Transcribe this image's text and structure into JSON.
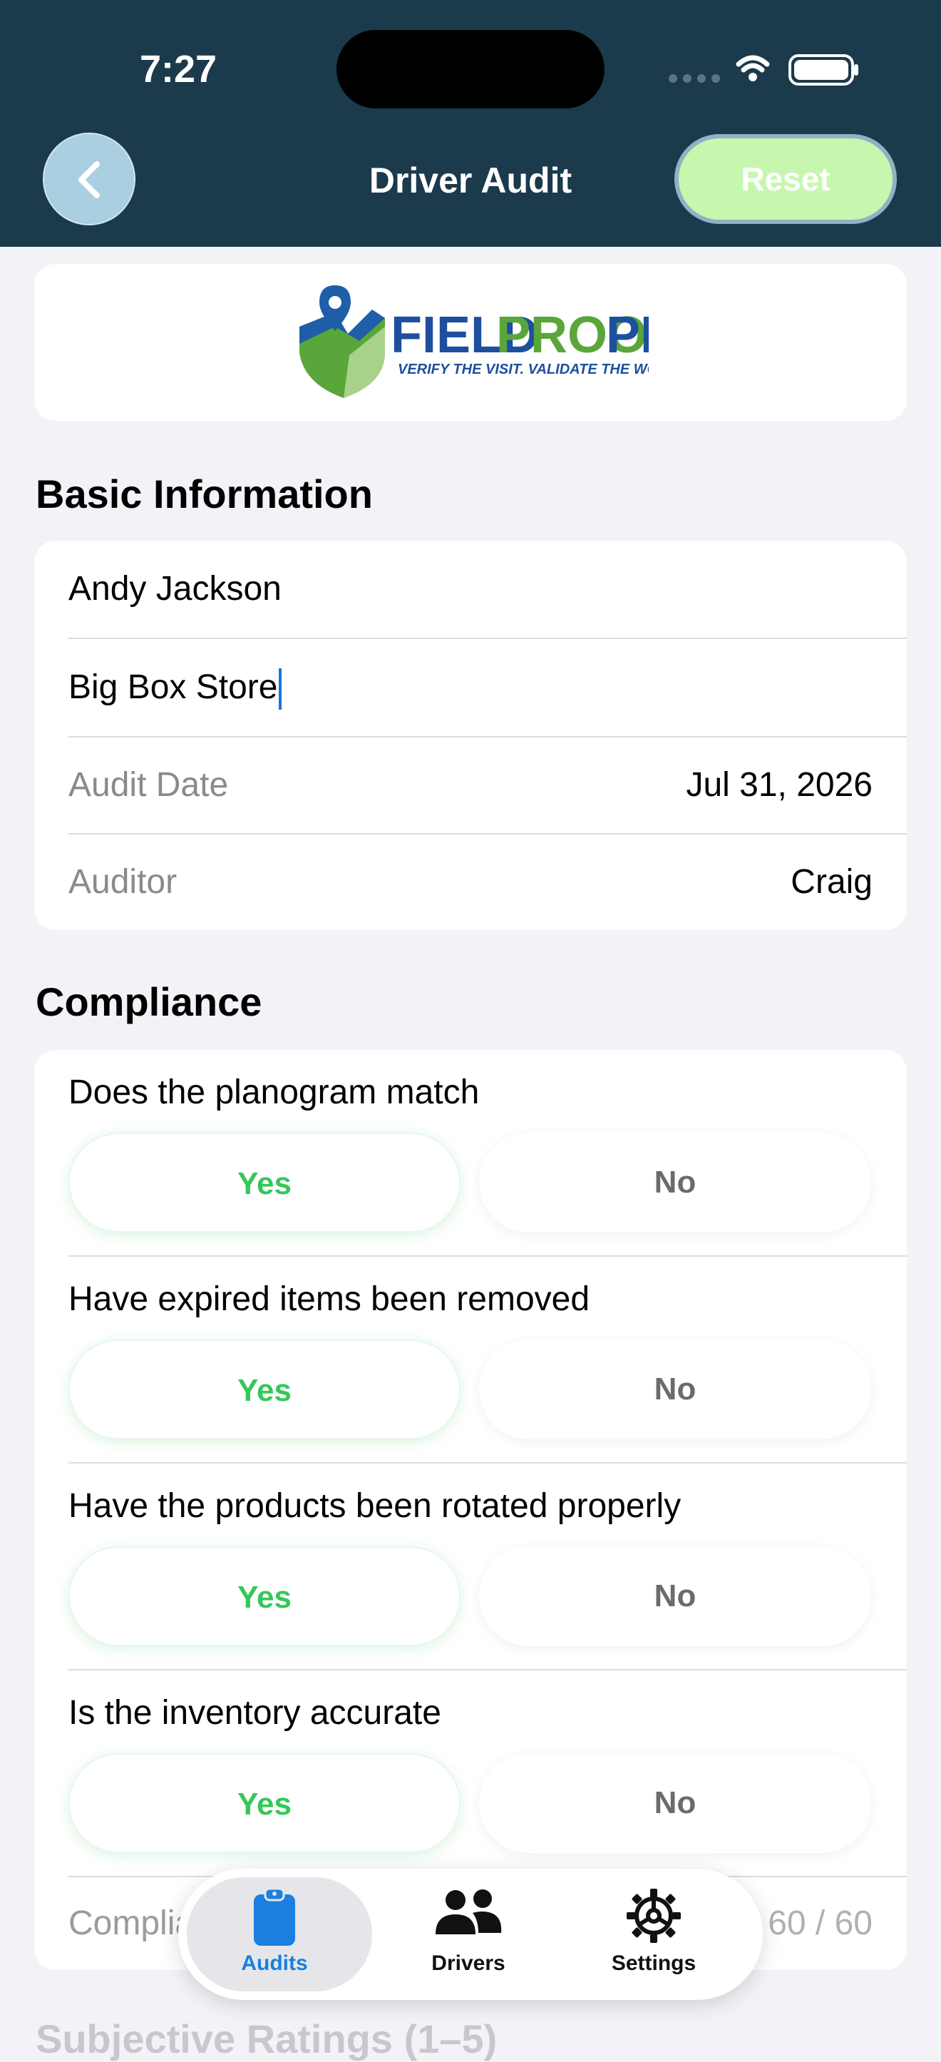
{
  "status": {
    "time": "7:27"
  },
  "nav": {
    "title": "Driver Audit",
    "reset_label": "Reset"
  },
  "logo": {
    "brand_left": "FIELD",
    "brand_mid": "PROOF",
    "brand_right": "PRO",
    "tagline": "VERIFY THE VISIT. VALIDATE THE WORK."
  },
  "basic": {
    "section_title": "Basic Information",
    "driver_name": "Andy Jackson",
    "store_name": "Big Box Store",
    "audit_date_label": "Audit Date",
    "audit_date_value": "Jul 31, 2026",
    "auditor_label": "Auditor",
    "auditor_value": "Craig"
  },
  "compliance": {
    "section_title": "Compliance",
    "questions": [
      {
        "text": "Does the planogram match",
        "yes": "Yes",
        "no": "No"
      },
      {
        "text": "Have expired items been removed",
        "yes": "Yes",
        "no": "No"
      },
      {
        "text": "Have the products been rotated properly",
        "yes": "Yes",
        "no": "No"
      },
      {
        "text": "Is the inventory accurate",
        "yes": "Yes",
        "no": "No"
      }
    ],
    "score_label": "Compliance Score",
    "score_value": "60 / 60"
  },
  "next_section": "Subjective Ratings (1–5)",
  "tabs": [
    {
      "label": "Audits",
      "icon": "clipboard-icon"
    },
    {
      "label": "Drivers",
      "icon": "people-icon"
    },
    {
      "label": "Settings",
      "icon": "gear-icon"
    }
  ],
  "colors": {
    "header": "#1b3a4b",
    "yes": "#34c759",
    "reset": "#c7f7ae",
    "tab_active": "#1a7fe0"
  }
}
